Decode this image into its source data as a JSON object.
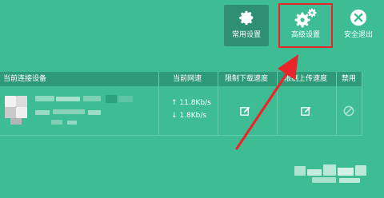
{
  "toolbar": {
    "common_settings_label": "常用设置",
    "advanced_settings_label": "高级设置",
    "logout_label": "安全退出"
  },
  "table": {
    "headers": [
      "当前连接设备",
      "当前网速",
      "限制下载速度",
      "限制上传速度",
      "禁用"
    ],
    "rows": [
      {
        "download_speed": "↑ 11.8Kb/s",
        "upload_speed": "↓ 1.8Kb/s"
      }
    ]
  },
  "colors": {
    "background": "#3ebd95",
    "header_bar": "#2f9a78",
    "highlight": "#e8262a"
  },
  "icons": [
    "gear-icon",
    "gears-icon",
    "close-circle-icon",
    "edit-icon",
    "ban-icon"
  ]
}
